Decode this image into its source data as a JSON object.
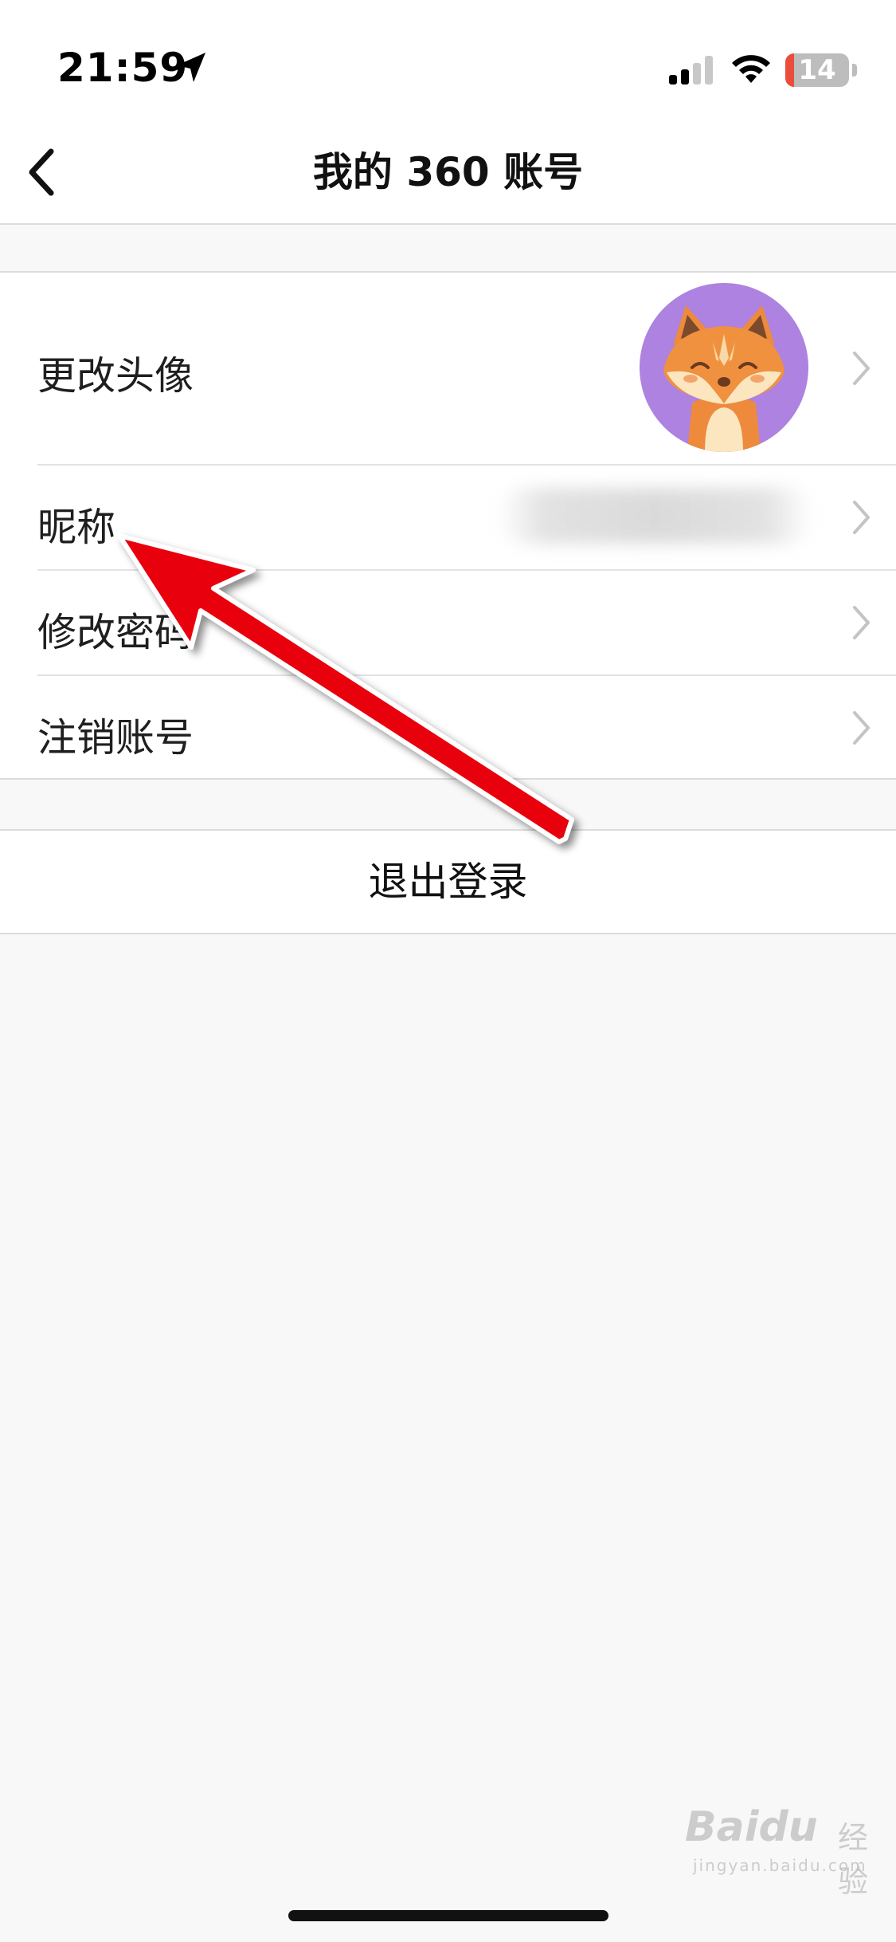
{
  "status_bar": {
    "time": "21:59",
    "battery_level": "14",
    "battery_fraction": 0.14,
    "icons": [
      "location-arrow-icon",
      "signal-icon",
      "wifi-icon",
      "battery-icon"
    ]
  },
  "nav": {
    "title": "我的 360 账号",
    "back_icon": "chevron-left-icon"
  },
  "settings": {
    "rows": [
      {
        "label": "更改头像",
        "icon": "chevron-right-icon"
      },
      {
        "label": "昵称",
        "icon": "chevron-right-icon"
      },
      {
        "label": "修改密码",
        "icon": "chevron-right-icon"
      },
      {
        "label": "注销账号",
        "icon": "chevron-right-icon"
      }
    ]
  },
  "logout": {
    "label": "退出登录"
  },
  "watermark": {
    "logo": "Baidu",
    "sub": "经验",
    "url": "jingyan.baidu.com"
  },
  "colors": {
    "background": "#f8f8f8",
    "avatar_bg": "#ad82e0",
    "annotation_arrow": "#e8000b",
    "battery_low": "#eb4d3d"
  }
}
